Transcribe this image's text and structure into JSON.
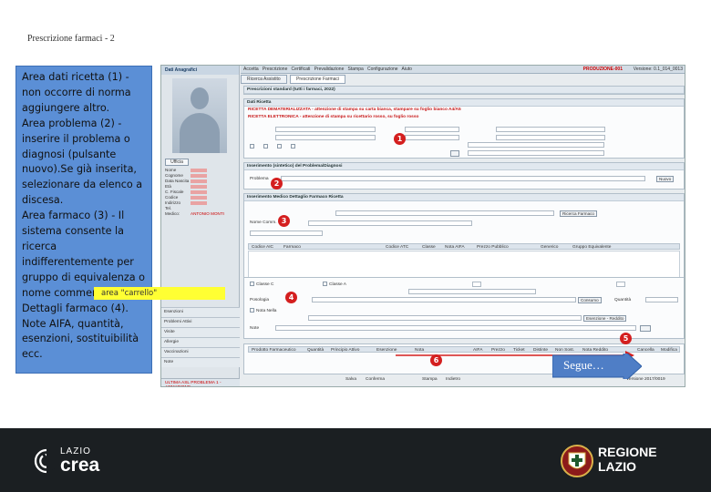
{
  "slide": {
    "title": "Prescrizione farmaci - 2",
    "description_lines": [
      "Area dati ricetta (1) -",
      "non occorre di norma",
      "aggiungere altro.",
      "Area problema (2) -",
      "inserire il  problema o",
      "diagnosi (pulsante",
      "nuovo).Se già inserita,",
      "selezionare da elenco a",
      "discesa.",
      "Area farmaco (3) - Il",
      "sistema consente la",
      "ricerca",
      "indifferentemente per",
      "gruppo di equivalenza o",
      "nome commerciale.",
      "Dettagli farmaco (4).",
      "Note AIFA, quantità,",
      "esenzioni, sostituibilità",
      "ecc."
    ],
    "next_button": "Segue…",
    "cart_label": "area \"carrello\"",
    "badges": [
      "1",
      "2",
      "3",
      "4",
      "5",
      "6"
    ]
  },
  "app": {
    "left_header": "Dati Anagrafici",
    "photo_button": "Ufficia",
    "patient_fields": [
      "Nome",
      "Cognome",
      "Data Nascita",
      "Età",
      "C. Fiscale",
      "Codice",
      "Indirizzo",
      "Tel."
    ],
    "medico_label": "Medico:",
    "medico_value": "ANTONIO MONTI",
    "menu_items": [
      "Esenzioni",
      "Problemi Attivi",
      "Visite",
      "Allergie",
      "Vaccinazioni",
      "Note"
    ],
    "footer_text": "ULTIMA ASL PROBLEMA 1 - ARMATIONE",
    "top_menu": [
      "Accetta",
      "Prescrizione",
      "Certificati",
      "Prevalidazione",
      "Stampa",
      "Configurazione",
      "Aiuto"
    ],
    "env_label": "PRODUZIONE-001",
    "version": "Versione: 0.1_014_0013",
    "tabs": [
      "Ricerca Assistito",
      "Prescrizione Farmaci"
    ],
    "sections": {
      "outside": "Prescrizioni standard (tutti i farmaci, 2022)",
      "dati_ricetta": "Dati Ricetta",
      "dati_ricetta_note_1": "RICETTA DEMATERIALIZZATA - attenzione di stampa su carta bianca, stampare su foglio bianco A4/A5",
      "dati_ricetta_note_2": "RICETTA ELETTRONICA - attenzione di stampa su ricettario rosso, su foglio rosso",
      "problema": "Inserimento (sintetico) del Problema/Diagnosi",
      "problema_label": "Problema",
      "problema_button": "Nuovo",
      "farmaco": "Inserimento Medico Dettaglio Farmaco Ricetta",
      "equivalenza_button": "Ricerca Farmaco",
      "nome_commerciale": "Nome Comm.",
      "table_headers": [
        "Codice AIC",
        "Farmaco",
        "Codice ATC",
        "Classe",
        "Nota AIFA",
        "Prezzo Pubblico",
        "Generico",
        "Gruppo Equivalente"
      ],
      "dettaglio_fields": [
        "Classe C",
        "Classe A",
        "Posologia",
        "Nota Nella",
        "Note"
      ],
      "note_button": "Consumo",
      "qta_label": "Quantità",
      "esenzione_button": "Esenzione - Reddito",
      "cart_headers": [
        "Prodotto Farmaceutico",
        "Quantità",
        "Principio Attivo",
        "Esenzione",
        "Nota",
        "AIFA",
        "Prezzo",
        "Ticket",
        "Distinte",
        "Non Sost.",
        "Nota Reddito",
        "Cancella",
        "Modifica"
      ],
      "bottom_buttons": [
        "Salva",
        "Conferma",
        "Stampa",
        "Indietro"
      ],
      "versione_btm": "Versione 2017/0019"
    }
  },
  "footer": {
    "left_logo_small": "LAZIO",
    "left_logo_big": "crea",
    "right_logo_line1": "REGIONE",
    "right_logo_line2": "LAZIO"
  },
  "colors": {
    "desc_box": "#5b8fd6",
    "badge_red": "#d41f1f",
    "cart_yellow": "#ffff33",
    "next_arrow": "#4f7ec6",
    "footer_bg": "#1b1f22"
  }
}
